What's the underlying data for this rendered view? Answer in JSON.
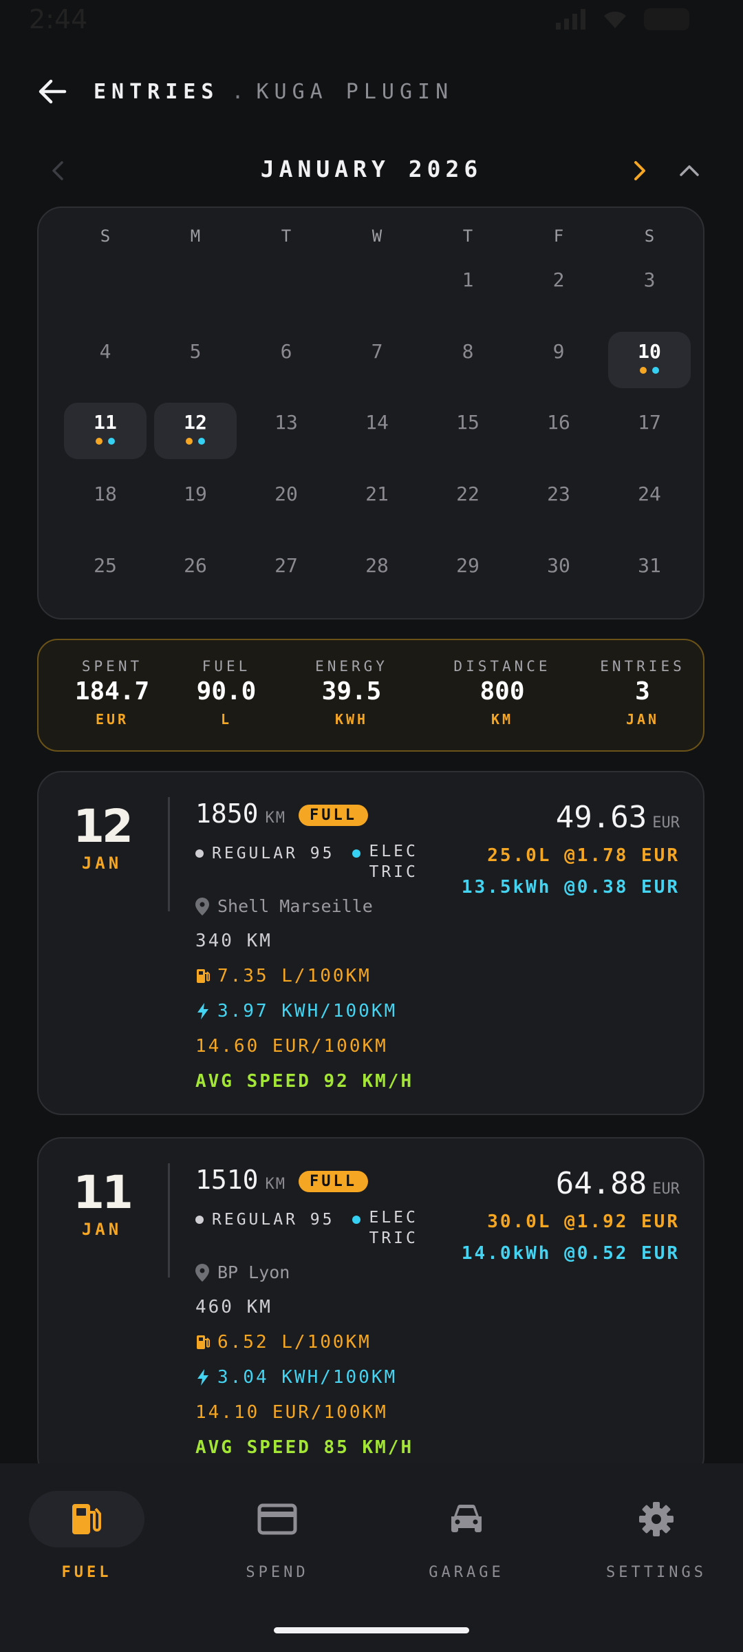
{
  "status": {
    "time": "2:44"
  },
  "header": {
    "title": "ENTRIES",
    "separator": ".",
    "subtitle": "KUGA PLUGIN"
  },
  "calendar": {
    "month": "JANUARY 2026",
    "weekdays": [
      "S",
      "M",
      "T",
      "W",
      "T",
      "F",
      "S"
    ],
    "days": [
      "1",
      "2",
      "3",
      "4",
      "5",
      "6",
      "7",
      "8",
      "9",
      "10",
      "11",
      "12",
      "13",
      "14",
      "15",
      "16",
      "17",
      "18",
      "19",
      "20",
      "21",
      "22",
      "23",
      "24",
      "25",
      "26",
      "27",
      "28",
      "29",
      "30",
      "31"
    ],
    "entry_days": [
      "10",
      "11",
      "12"
    ]
  },
  "stats": [
    {
      "label": "SPENT",
      "value": "184.7",
      "unit": "EUR"
    },
    {
      "label": "FUEL",
      "value": "90.0",
      "unit": "L"
    },
    {
      "label": "ENERGY",
      "value": "39.5",
      "unit": "KWH"
    },
    {
      "label": "DISTANCE",
      "value": "800",
      "unit": "KM"
    },
    {
      "label": "ENTRIES",
      "value": "3",
      "unit": "JAN"
    }
  ],
  "entries": [
    {
      "day": "12",
      "month": "JAN",
      "odometer": "1850",
      "odometer_unit": "KM",
      "badge": "FULL",
      "fuel_type": "REGULAR 95",
      "elec_line1": "ELEC",
      "elec_line2": "TRIC",
      "location": "Shell Marseille",
      "distance": "340 KM",
      "fuel_efficiency": "7.35 L/100KM",
      "elec_efficiency": "3.97 KWH/100KM",
      "cost_efficiency": "14.60 EUR/100KM",
      "avg_speed": "AVG SPEED 92 KM/H",
      "total": "49.63",
      "currency": "EUR",
      "fuel_detail": "25.0L @1.78 EUR",
      "elec_detail": "13.5kWh @0.38 EUR"
    },
    {
      "day": "11",
      "month": "JAN",
      "odometer": "1510",
      "odometer_unit": "KM",
      "badge": "FULL",
      "fuel_type": "REGULAR 95",
      "elec_line1": "ELEC",
      "elec_line2": "TRIC",
      "location": "BP Lyon",
      "distance": "460 KM",
      "fuel_efficiency": "6.52 L/100KM",
      "elec_efficiency": "3.04 KWH/100KM",
      "cost_efficiency": "14.10 EUR/100KM",
      "avg_speed": "AVG SPEED 85 KM/H",
      "total": "64.88",
      "currency": "EUR",
      "fuel_detail": "30.0L @1.92 EUR",
      "elec_detail": "14.0kWh @0.52 EUR"
    }
  ],
  "nav": [
    {
      "label": "FUEL",
      "icon": "fuel-pump-icon",
      "active": true
    },
    {
      "label": "SPEND",
      "icon": "credit-card-icon",
      "active": false
    },
    {
      "label": "GARAGE",
      "icon": "car-icon",
      "active": false
    },
    {
      "label": "SETTINGS",
      "icon": "gear-icon",
      "active": false
    }
  ],
  "colors": {
    "accent": "#f5a623",
    "electric": "#36d1f2",
    "speed": "#a3e635",
    "background": "#111214",
    "card": "#1b1c1f"
  }
}
